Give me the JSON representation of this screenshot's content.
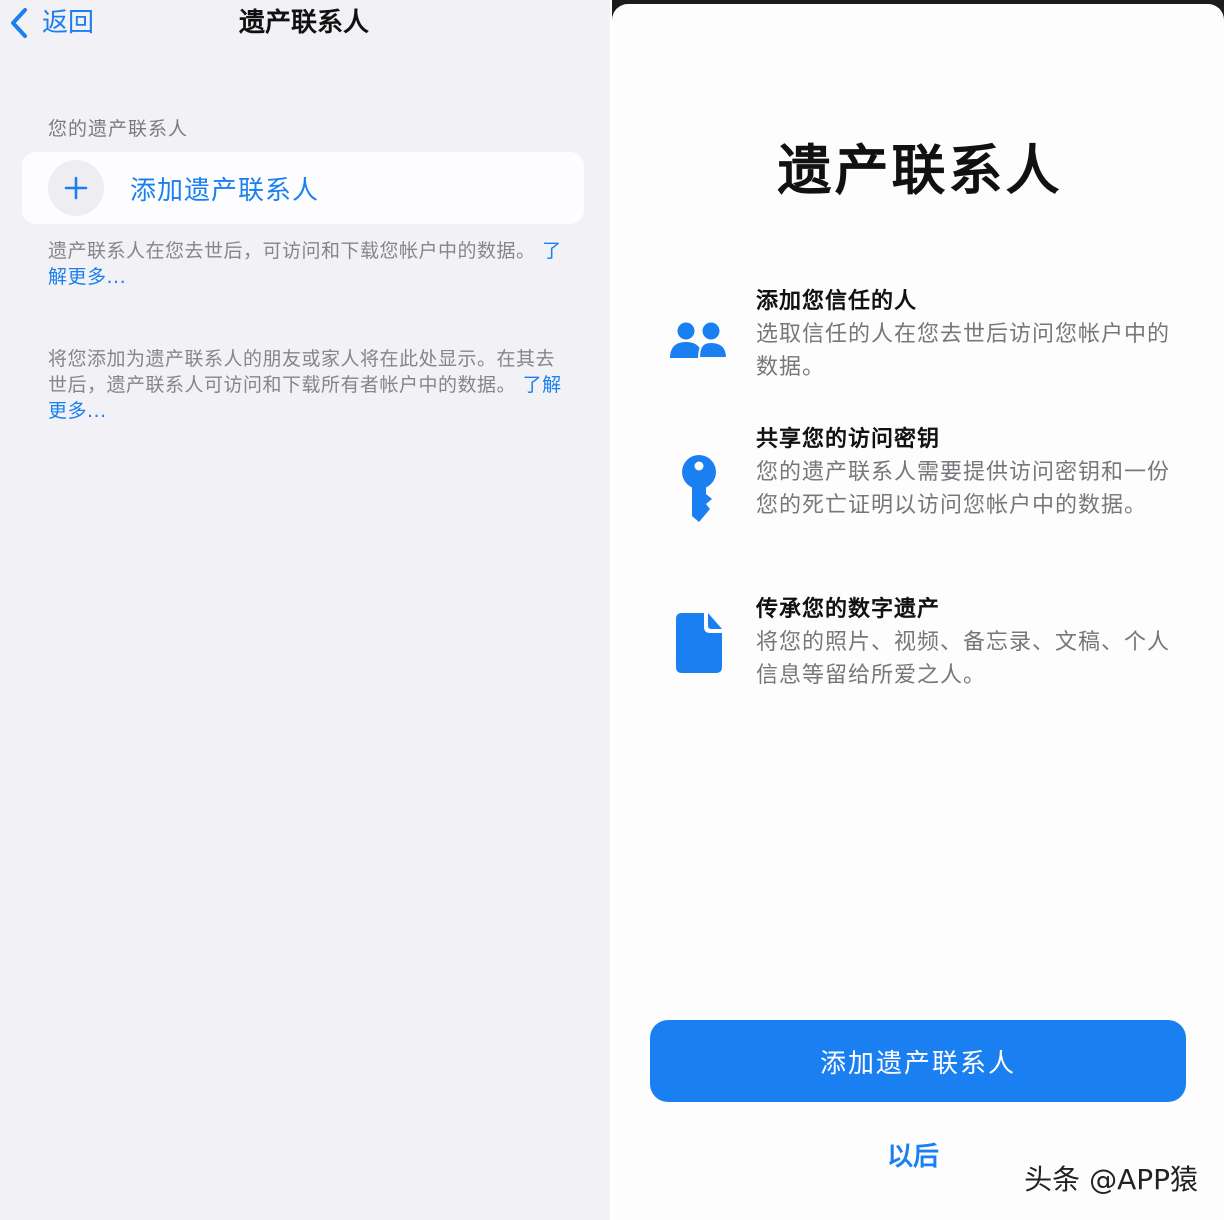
{
  "left_screen": {
    "nav": {
      "back_label": "返回",
      "title": "遗产联系人"
    },
    "section_header": "您的遗产联系人",
    "add_card_label": "添加遗产联系人",
    "footnote1": {
      "text": "遗产联系人在您去世后，可访问和下载您帐户中的数据。",
      "link": "了解更多..."
    },
    "footnote2": {
      "text": "将您添加为遗产联系人的朋友或家人将在此处显示。在其去世后，遗产联系人可访问和下载所有者帐户中的数据。",
      "link": "了解更多..."
    }
  },
  "right_screen": {
    "title": "遗产联系人",
    "features": [
      {
        "icon": "people-icon",
        "title": "添加您信任的人",
        "desc": "选取信任的人在您去世后访问您帐户中的数据。"
      },
      {
        "icon": "key-icon",
        "title": "共享您的访问密钥",
        "desc": "您的遗产联系人需要提供访问密钥和一份您的死亡证明以访问您帐户中的数据。"
      },
      {
        "icon": "document-icon",
        "title": "传承您的数字遗产",
        "desc": "将您的照片、视频、备忘录、文稿、个人信息等留给所爱之人。"
      }
    ],
    "primary_button": "添加遗产联系人",
    "secondary_button": "以后"
  },
  "watermark": "头条 @APP猿",
  "colors": {
    "accent": "#1a7ff0",
    "left_background": "#f2f2f6",
    "card_background": "#fdfdff",
    "secondary_text": "#85858a"
  }
}
